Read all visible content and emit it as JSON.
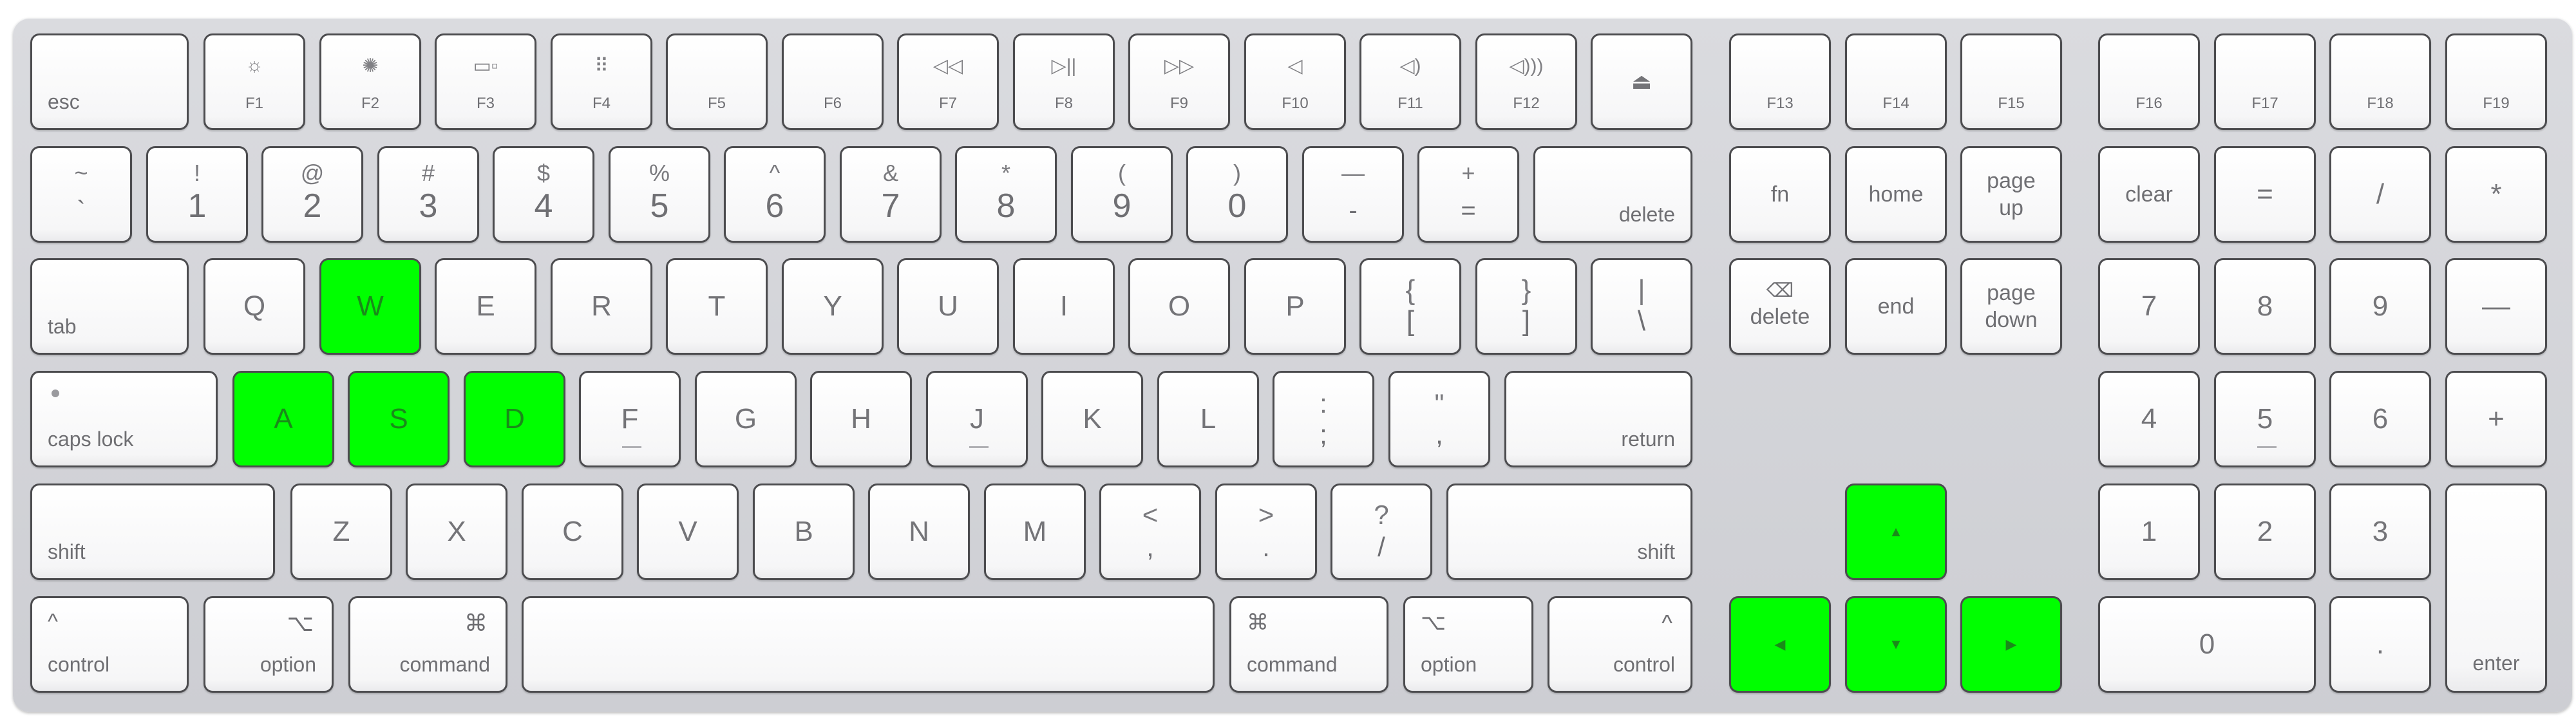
{
  "keyboard": {
    "function_row": {
      "esc": "esc",
      "f1": "F1",
      "f2": "F2",
      "f3": "F3",
      "f4": "F4",
      "f5": "F5",
      "f6": "F6",
      "f7": "F7",
      "f8": "F8",
      "f9": "F9",
      "f10": "F10",
      "f11": "F11",
      "f12": "F12",
      "f13": "F13",
      "f14": "F14",
      "f15": "F15",
      "f16": "F16",
      "f17": "F17",
      "f18": "F18",
      "f19": "F19",
      "icons": {
        "f1": "☼",
        "f2": "✺",
        "f3": "▭▫",
        "f4": "⠿",
        "f7": "◁◁",
        "f8": "▷||",
        "f9": "▷▷",
        "f10": "◁",
        "f11": "◁)",
        "f12": "◁)))",
        "eject": "⏏"
      }
    },
    "number_row": {
      "grave": {
        "shift": "~",
        "base": "`"
      },
      "k1": {
        "shift": "!",
        "base": "1"
      },
      "k2": {
        "shift": "@",
        "base": "2"
      },
      "k3": {
        "shift": "#",
        "base": "3"
      },
      "k4": {
        "shift": "$",
        "base": "4"
      },
      "k5": {
        "shift": "%",
        "base": "5"
      },
      "k6": {
        "shift": "^",
        "base": "6"
      },
      "k7": {
        "shift": "&",
        "base": "7"
      },
      "k8": {
        "shift": "*",
        "base": "8"
      },
      "k9": {
        "shift": "(",
        "base": "9"
      },
      "k0": {
        "shift": ")",
        "base": "0"
      },
      "minus": {
        "shift": "—",
        "base": "-"
      },
      "equal": {
        "shift": "+",
        "base": "="
      },
      "delete": "delete"
    },
    "qwerty_row": {
      "tab": "tab",
      "letters": [
        "Q",
        "W",
        "E",
        "R",
        "T",
        "Y",
        "U",
        "I",
        "O",
        "P"
      ],
      "lbracket": {
        "shift": "{",
        "base": "["
      },
      "rbracket": {
        "shift": "}",
        "base": "]"
      },
      "backslash": {
        "shift": "|",
        "base": "\\"
      }
    },
    "home_row": {
      "caps": "caps lock",
      "letters": [
        "A",
        "S",
        "D",
        "F",
        "G",
        "H",
        "J",
        "K",
        "L"
      ],
      "semicolon": {
        "shift": ":",
        "base": ";"
      },
      "quote": {
        "shift": "\"",
        "base": ","
      },
      "return": "return"
    },
    "bottom_letter_row": {
      "shift": "shift",
      "letters": [
        "Z",
        "X",
        "C",
        "V",
        "B",
        "N",
        "M"
      ],
      "comma": {
        "shift": "<",
        "base": ","
      },
      "period": {
        "shift": ">",
        "base": "."
      },
      "slash": {
        "shift": "?",
        "base": "/"
      }
    },
    "modifier_row": {
      "control": "control",
      "option": "option",
      "command": "command",
      "icons": {
        "control": "^",
        "option": "⌥",
        "command": "⌘"
      }
    },
    "nav_cluster": {
      "fn": "fn",
      "home": "home",
      "page_up": "page\nup",
      "delete": "delete",
      "end": "end",
      "page_down": "page\ndown",
      "delete_icon": "⌫"
    },
    "arrows": {
      "up": "▲",
      "left": "◀",
      "down": "▼",
      "right": "▶"
    },
    "numpad": {
      "clear": "clear",
      "equal": "=",
      "slash": "/",
      "star": "*",
      "n7": "7",
      "n8": "8",
      "n9": "9",
      "minus": "—",
      "n4": "4",
      "n5": "5",
      "n6": "6",
      "plus": "+",
      "n1": "1",
      "n2": "2",
      "n3": "3",
      "n0": "0",
      "dot": ".",
      "enter": "enter"
    },
    "highlight_color": "#00ff00",
    "highlighted_keys": [
      "W",
      "A",
      "S",
      "D",
      "up",
      "left",
      "down",
      "right"
    ]
  }
}
